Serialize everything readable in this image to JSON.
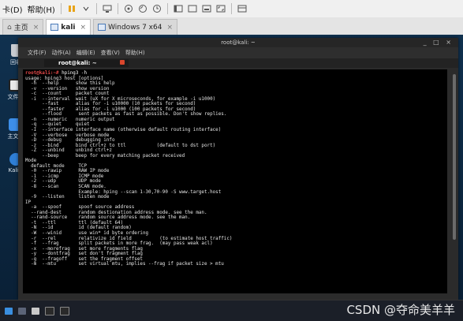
{
  "vm_menu": {
    "items": [
      "卡(D)",
      "帮助(H)"
    ]
  },
  "tabs": [
    {
      "label": "主页",
      "active": false
    },
    {
      "label": "kali",
      "active": true
    },
    {
      "label": "Windows 7 x64",
      "active": false
    }
  ],
  "desktop_icons": [
    {
      "label": "回收"
    },
    {
      "label": "文件系"
    },
    {
      "label": "主文件"
    },
    {
      "label": "Kali L"
    }
  ],
  "terminal": {
    "window_title": "root@kali: ~",
    "controls": "_ □ ×",
    "menu": [
      "文件(F)",
      "动作(A)",
      "编辑(E)",
      "查看(V)",
      "帮助(H)"
    ],
    "tab_label": "root@kali: ~",
    "prompt": "root@kali:~#",
    "command": " hping3 -h",
    "lines": [
      "usage: hping3 host [options]",
      "  -h  --help      show this help",
      "  -v  --version   show version",
      "  -c  --count     packet count",
      "  -i  --interval  wait (uX for X microseconds, for example -i u1000)",
      "      --fast      alias for -i u10000 (10 packets for second)",
      "      --faster    alias for -i u1000 (100 packets for second)",
      "      --flood      sent packets as fast as possible. Don't show replies.",
      "  -n  --numeric   numeric output",
      "  -q  --quiet     quiet",
      "  -I  --interface interface name (otherwise default routing interface)",
      "  -V  --verbose   verbose mode",
      "  -D  --debug     debugging info",
      "  -z  --bind      bind ctrl+z to ttl           (default to dst port)",
      "  -Z  --unbind    unbind ctrl+z",
      "      --beep      beep for every matching packet received",
      "Mode",
      "  default mode     TCP",
      "  -0  --rawip      RAW IP mode",
      "  -1  --icmp       ICMP mode",
      "  -2  --udp        UDP mode",
      "  -8  --scan       SCAN mode.",
      "                   Example: hping --scan 1-30,70-90 -S www.target.host",
      "  -9  --listen     listen mode",
      "IP",
      "  -a  --spoof      spoof source address",
      "  --rand-dest      random destionation address mode. see the man.",
      "  --rand-source    random source address mode. see the man.",
      "  -t  --ttl        ttl (default 64)",
      "  -N  --id         id (default random)",
      "  -W  --winid      use win* id byte ordering",
      "  -r  --rel        relativize id field          (to estimate host traffic)",
      "  -f  --frag       split packets in more frag.  (may pass weak acl)",
      "  -x  --morefrag   set more fragments flag",
      "  -y  --dontfrag   set don't fragment flag",
      "  -g  --fragoff    set the fragment offset",
      "  -m  --mtu        set virtual mtu, implies --frag if packet size > mtu"
    ]
  },
  "watermark": "CSDN @夺命美羊羊",
  "colors": {
    "prompt": "#e64a4a",
    "terminal_bg": "#000000",
    "desktop_bg": "#10314f"
  }
}
